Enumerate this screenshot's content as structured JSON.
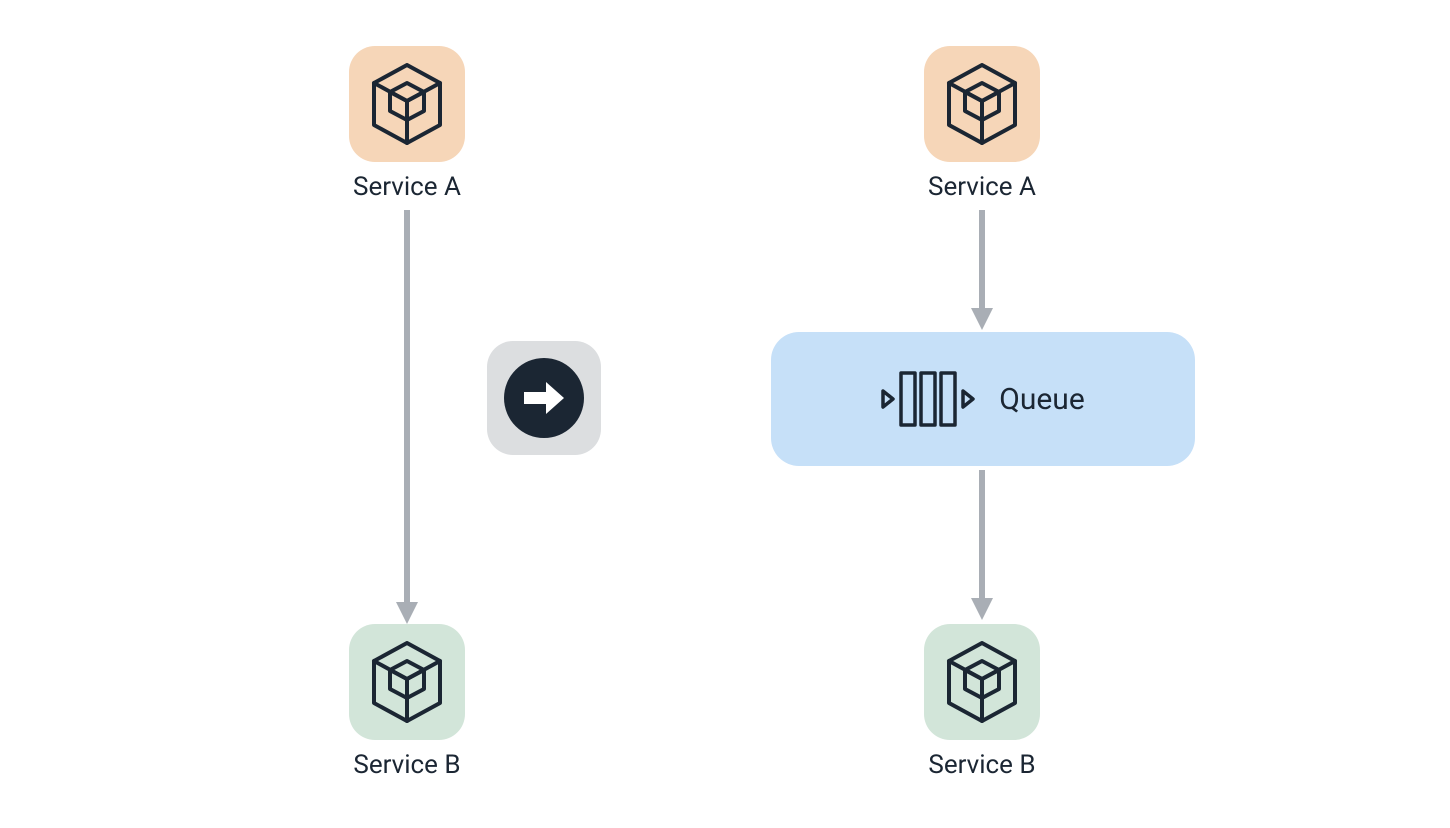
{
  "left": {
    "serviceA": {
      "label": "Service A"
    },
    "serviceB": {
      "label": "Service B"
    }
  },
  "right": {
    "serviceA": {
      "label": "Service A"
    },
    "queue": {
      "label": "Queue"
    },
    "serviceB": {
      "label": "Service B"
    }
  },
  "colors": {
    "peach": "#f6d6b8",
    "mint": "#d2e5d9",
    "blue": "#c6e0f8",
    "ink": "#1b2633",
    "arrow": "#a9aeb5",
    "badge": "#dcdee0"
  }
}
